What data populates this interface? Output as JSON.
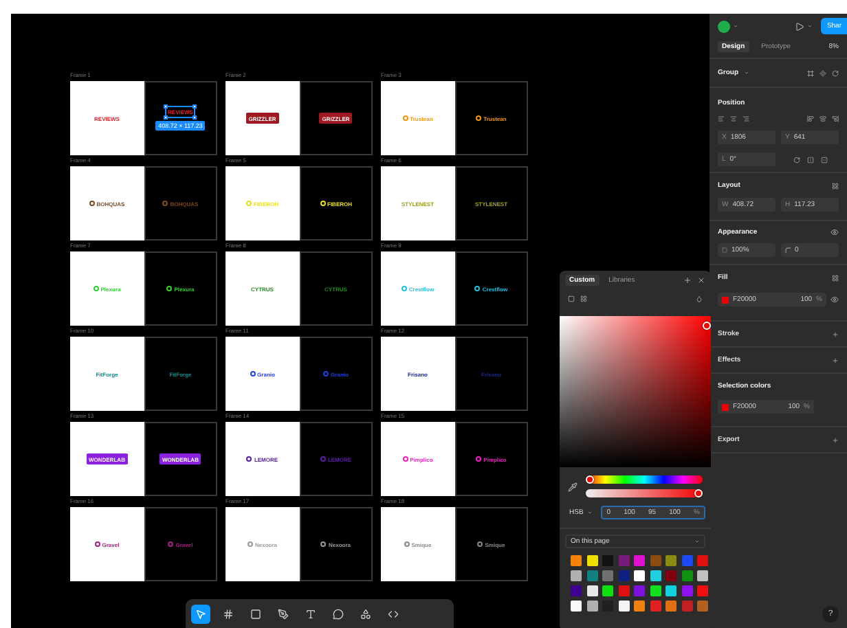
{
  "canvas": {
    "selection_size": "408.72 × 117.23",
    "frames": [
      {
        "label": "Frame 1",
        "logo": [
          "REVIEWS",
          "REVIEWS"
        ],
        "kind": "plain",
        "color": "#e0202a",
        "selected": true
      },
      {
        "label": "Frame 2",
        "logo": [
          "GRIZZLER",
          "GRIZZLER"
        ],
        "kind": "badge",
        "color": "#a01820",
        "selected": false
      },
      {
        "label": "Frame 3",
        "logo": [
          "Trustean",
          "Trustean"
        ],
        "kind": "icon",
        "color": "#f0960a",
        "selected": false
      },
      {
        "label": "Frame 4",
        "logo": [
          "BOHQUAS",
          "BOHQUAS"
        ],
        "kind": "icon",
        "color": "#7a4a20",
        "selected": false
      },
      {
        "label": "Frame 5",
        "logo": [
          "FIBEROH",
          "FIBEROH"
        ],
        "kind": "icon",
        "color": "#e8e020",
        "selected": false
      },
      {
        "label": "Frame 6",
        "logo": [
          "STYLENEST",
          "STYLENEST"
        ],
        "kind": "plain",
        "color": "#a0a020",
        "selected": false
      },
      {
        "label": "Frame 7",
        "logo": [
          "Plexura",
          "Plexura"
        ],
        "kind": "icon",
        "color": "#30d030",
        "selected": false
      },
      {
        "label": "Frame 8",
        "logo": [
          "CYTRUS",
          "CYTRUS"
        ],
        "kind": "plain",
        "color": "#208a20",
        "selected": false
      },
      {
        "label": "Frame 9",
        "logo": [
          "Crestflow",
          "Crestflow"
        ],
        "kind": "icon",
        "color": "#20c0e0",
        "selected": false
      },
      {
        "label": "Frame 10",
        "logo": [
          "FitForge",
          "FitForge"
        ],
        "kind": "plain",
        "color": "#108a8a",
        "selected": false
      },
      {
        "label": "Frame 11",
        "logo": [
          "Granio",
          "Granio"
        ],
        "kind": "icon",
        "color": "#2040e0",
        "selected": false
      },
      {
        "label": "Frame 12",
        "logo": [
          "Frisano",
          "Frisano"
        ],
        "kind": "plain",
        "color": "#1a2a8a",
        "selected": false
      },
      {
        "label": "Frame 13",
        "logo": [
          "WONDERLAB",
          "WONDERLAB"
        ],
        "kind": "badge",
        "color": "#8a20e0",
        "selected": false
      },
      {
        "label": "Frame 14",
        "logo": [
          "LEMORE",
          "LEMORE"
        ],
        "kind": "icon",
        "color": "#5a20a0",
        "selected": false
      },
      {
        "label": "Frame 15",
        "logo": [
          "Pimplico",
          "Pimplico"
        ],
        "kind": "icon",
        "color": "#f020c0",
        "selected": false
      },
      {
        "label": "Frame 16",
        "logo": [
          "Gravel",
          "Gravel"
        ],
        "kind": "icon",
        "color": "#a02080",
        "selected": false
      },
      {
        "label": "Frame 17",
        "logo": [
          "Nexoora",
          "Nexoora"
        ],
        "kind": "icon",
        "color": "#9a9a9a",
        "selected": false
      },
      {
        "label": "Frame 18",
        "logo": [
          "Smique",
          "Smique"
        ],
        "kind": "icon",
        "color": "#8a8a8a",
        "selected": false
      }
    ]
  },
  "toolbar": {
    "tools": [
      {
        "kind": "move",
        "selected": true
      },
      {
        "kind": "frame",
        "selected": false
      },
      {
        "kind": "shape",
        "selected": false
      },
      {
        "kind": "pen",
        "selected": false
      },
      {
        "kind": "text",
        "selected": false
      },
      {
        "kind": "comment",
        "selected": false
      },
      {
        "kind": "actions",
        "selected": false
      },
      {
        "kind": "code",
        "selected": false
      }
    ]
  },
  "color_picker": {
    "tabs": [
      {
        "label": "Custom",
        "selected": true
      },
      {
        "label": "Libraries",
        "selected": false
      }
    ],
    "hue": {
      "level": 0
    },
    "alpha": {
      "level": 1
    },
    "mode": "HSB",
    "values": [
      "0",
      "100",
      "95",
      "100"
    ],
    "unit": "%",
    "library": "On this page",
    "swatches": [
      {
        "color": "#f5820d"
      },
      {
        "color": "#f0e000"
      },
      {
        "color": "#111111"
      },
      {
        "color": "#7a1a7a"
      },
      {
        "color": "#e010d0"
      },
      {
        "color": "#8a4a10"
      },
      {
        "color": "#8a8a10"
      },
      {
        "color": "#1a4af0"
      },
      {
        "color": "#e01010"
      },
      {
        "color": "#b0b0b0"
      },
      {
        "color": "#108080"
      },
      {
        "color": "#707070"
      },
      {
        "color": "#102080"
      },
      {
        "color": "#ffffff"
      },
      {
        "color": "#20d0e0"
      },
      {
        "color": "#800010"
      },
      {
        "color": "#109010"
      },
      {
        "color": "#c0c0c0"
      },
      {
        "color": "#400090"
      },
      {
        "color": "#e8e8e8"
      },
      {
        "color": "#10e010"
      },
      {
        "color": "#e01010"
      },
      {
        "color": "#8010e0"
      },
      {
        "color": "#10e020"
      },
      {
        "color": "#10d0e0"
      },
      {
        "color": "#9010f0"
      },
      {
        "color": "#f01010"
      },
      {
        "color": "#fafafa"
      },
      {
        "color": "#b0b0b0"
      },
      {
        "color": "#202020"
      },
      {
        "color": "#f4f4f4"
      },
      {
        "color": "#f08010"
      },
      {
        "color": "#e02020"
      },
      {
        "color": "#e07010"
      },
      {
        "color": "#c02020"
      },
      {
        "color": "#b06020"
      }
    ]
  },
  "inspector": {
    "share": "Shar",
    "tabs": [
      {
        "label": "Design",
        "selected": true
      },
      {
        "label": "Prototype",
        "selected": false
      }
    ],
    "zoom": "8%",
    "layer": "Group",
    "position": {
      "title": "Position",
      "x": {
        "label": "X",
        "value": "1806"
      },
      "y": {
        "label": "Y",
        "value": "641"
      },
      "rotation": {
        "label": "L",
        "value": "0°"
      }
    },
    "layout": {
      "title": "Layout",
      "w": {
        "label": "W",
        "value": "408.72"
      },
      "h": {
        "label": "H",
        "value": "117.23"
      }
    },
    "appearance": {
      "title": "Appearance",
      "opacity": "100%",
      "radius": "0"
    },
    "fill": {
      "title": "Fill",
      "hex": "F20000",
      "opacity": "100",
      "unit": "%",
      "color": "#f20000"
    },
    "collapsed": [
      "Stroke",
      "Effects"
    ],
    "selection_colors": {
      "title": "Selection colors",
      "hex": "F20000",
      "opacity": "100",
      "unit": "%",
      "color": "#f20000"
    },
    "export": "Export",
    "help": "?"
  }
}
